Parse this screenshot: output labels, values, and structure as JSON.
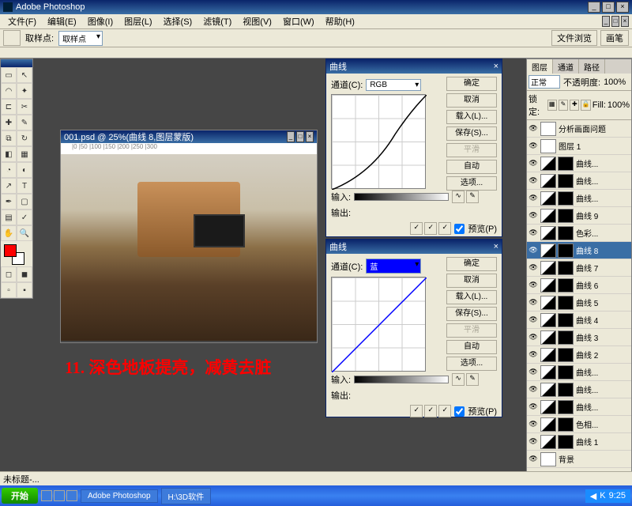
{
  "app": {
    "title": "Adobe Photoshop"
  },
  "menu": [
    "文件(F)",
    "编辑(E)",
    "图像(I)",
    "图层(L)",
    "选择(S)",
    "滤镜(T)",
    "视图(V)",
    "窗口(W)",
    "帮助(H)"
  ],
  "optbar": {
    "label": "取样点:",
    "value": "取样点",
    "tabs": [
      "文件浏览",
      "画笔"
    ]
  },
  "img_win": {
    "title": "001.psd @ 25%(曲线 8,图层蒙版)"
  },
  "annotation": "11. 深色地板提亮，减黄去脏",
  "curves1": {
    "title": "曲线",
    "channel_label": "通道(C):",
    "channel": "RGB",
    "btns": [
      "确定",
      "取消",
      "载入(L)...",
      "保存(S)...",
      "平滑",
      "自动",
      "选项..."
    ],
    "input_label": "输入:",
    "output_label": "输出:",
    "preview": "预览(P)"
  },
  "curves2": {
    "title": "曲线",
    "channel_label": "通道(C):",
    "channel": "蓝",
    "btns": [
      "确定",
      "取消",
      "载入(L)...",
      "保存(S)...",
      "平滑",
      "自动",
      "选项..."
    ],
    "input_label": "输入:",
    "output_label": "输出:",
    "preview": "预览(P)"
  },
  "layers": {
    "tabs": [
      "图层",
      "通道",
      "路径"
    ],
    "blend": "正常",
    "opacity_label": "不透明度:",
    "opacity": "100%",
    "lock_label": "锁定:",
    "fill_label": "Fill:",
    "fill": "100%",
    "items": [
      {
        "name": "分析画面问题",
        "type": "text"
      },
      {
        "name": "图层 1",
        "type": "img"
      },
      {
        "name": "曲线...",
        "type": "curves"
      },
      {
        "name": "曲线...",
        "type": "curves"
      },
      {
        "name": "曲线...",
        "type": "curves"
      },
      {
        "name": "曲线 9",
        "type": "curves"
      },
      {
        "name": "色彩...",
        "type": "adj"
      },
      {
        "name": "曲线 8",
        "type": "curves",
        "sel": true
      },
      {
        "name": "曲线 7",
        "type": "curves"
      },
      {
        "name": "曲线 6",
        "type": "curves"
      },
      {
        "name": "曲线 5",
        "type": "curves"
      },
      {
        "name": "曲线 4",
        "type": "curves"
      },
      {
        "name": "曲线 3",
        "type": "curves"
      },
      {
        "name": "曲线 2",
        "type": "curves"
      },
      {
        "name": "曲线...",
        "type": "curves"
      },
      {
        "name": "曲线...",
        "type": "curves"
      },
      {
        "name": "曲线...",
        "type": "curves"
      },
      {
        "name": "色相...",
        "type": "adj"
      },
      {
        "name": "曲线 1",
        "type": "curves"
      },
      {
        "name": "背景",
        "type": "bg"
      }
    ]
  },
  "taskbar": {
    "start": "开始",
    "items": [
      "Adobe Photoshop",
      "H:\\3D软件"
    ],
    "time": "9:25"
  },
  "status": "未标题-..."
}
